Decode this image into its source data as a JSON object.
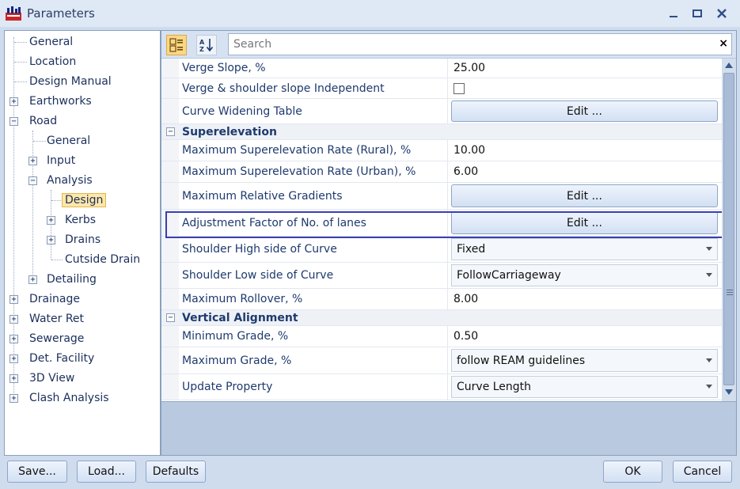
{
  "window": {
    "title": "Parameters"
  },
  "tree": {
    "items": [
      {
        "label": "General"
      },
      {
        "label": "Location"
      },
      {
        "label": "Design Manual"
      },
      {
        "label": "Earthworks"
      },
      {
        "label": "Road"
      },
      {
        "label": "General"
      },
      {
        "label": "Input"
      },
      {
        "label": "Analysis"
      },
      {
        "label": "Design"
      },
      {
        "label": "Kerbs"
      },
      {
        "label": "Drains"
      },
      {
        "label": "Cutside Drain"
      },
      {
        "label": "Detailing"
      },
      {
        "label": "Drainage"
      },
      {
        "label": "Water Ret"
      },
      {
        "label": "Sewerage"
      },
      {
        "label": "Det. Facility"
      },
      {
        "label": "3D View"
      },
      {
        "label": "Clash Analysis"
      }
    ]
  },
  "search": {
    "placeholder": "Search",
    "clear": "×"
  },
  "grid": {
    "rows": [
      {
        "name": "Verge Slope, %",
        "value": "25.00"
      },
      {
        "name": "Verge & shoulder slope Independent",
        "value": ""
      },
      {
        "name": "Curve Widening Table",
        "value": "Edit ..."
      },
      {
        "name": "Superelevation",
        "value": ""
      },
      {
        "name": "Maximum Superelevation Rate (Rural), %",
        "value": "10.00"
      },
      {
        "name": "Maximum Superelevation Rate (Urban), %",
        "value": "6.00"
      },
      {
        "name": "Maximum Relative Gradients",
        "value": "Edit ..."
      },
      {
        "name": "Adjustment Factor of No. of lanes",
        "value": "Edit ..."
      },
      {
        "name": "Shoulder High side of Curve",
        "value": "Fixed"
      },
      {
        "name": "Shoulder Low side of Curve",
        "value": "FollowCarriageway"
      },
      {
        "name": "Maximum Rollover, %",
        "value": "8.00"
      },
      {
        "name": "Vertical Alignment",
        "value": ""
      },
      {
        "name": "Minimum Grade, %",
        "value": "0.50"
      },
      {
        "name": "Maximum Grade, %",
        "value": "follow REAM guidelines"
      },
      {
        "name": "Update Property",
        "value": "Curve Length"
      }
    ]
  },
  "buttons": {
    "save": "Save...",
    "load": "Load...",
    "defaults": "Defaults",
    "ok": "OK",
    "cancel": "Cancel"
  },
  "colors": {
    "accent": "#3b3fb0",
    "selection": "#fde7a9"
  }
}
